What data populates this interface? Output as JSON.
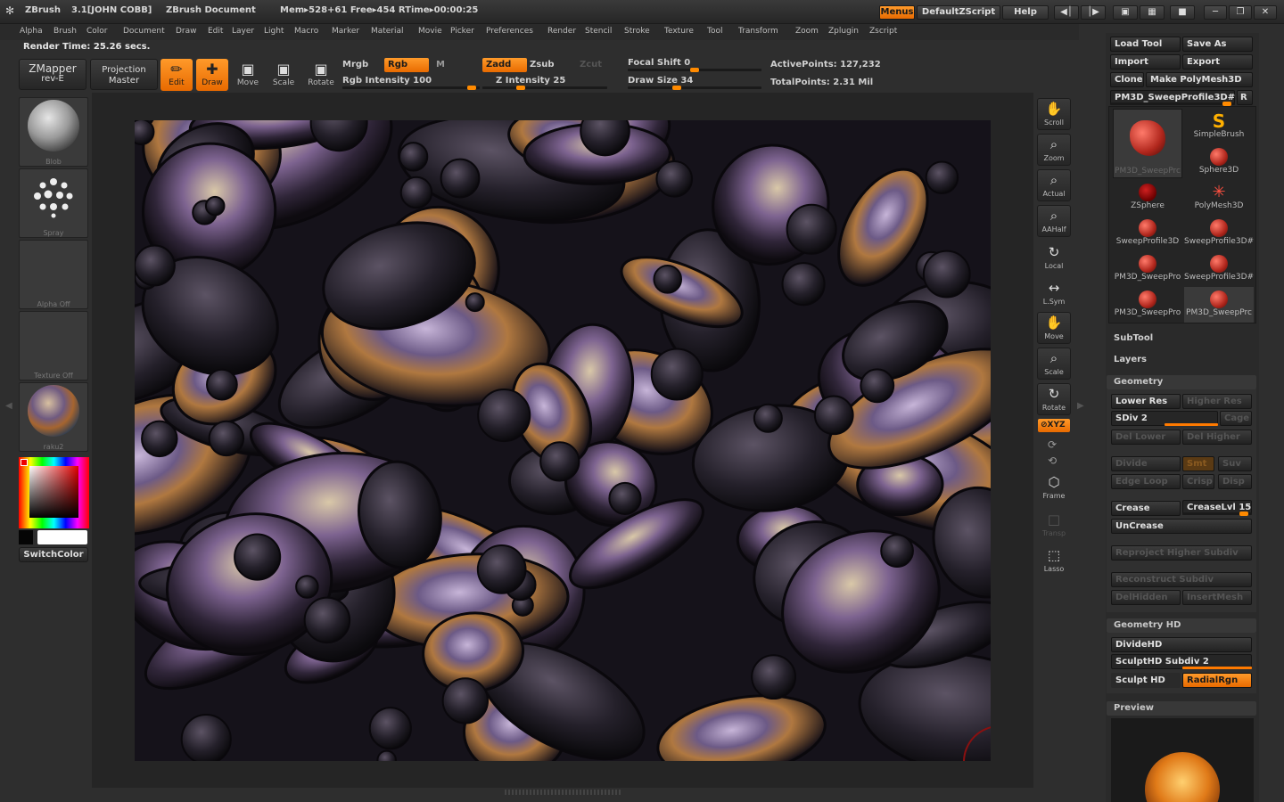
{
  "titlebar": {
    "app": "ZBrush",
    "version": "3.1[JOHN COBB]",
    "doc": "ZBrush Document",
    "mem": "Mem▸528+61 Free▸454 RTime▸00:00:25",
    "menus": "Menus",
    "script": "DefaultZScript",
    "help": "Help"
  },
  "menu": [
    "Alpha",
    "Brush",
    "Color",
    "Document",
    "Draw",
    "Edit",
    "Layer",
    "Light",
    "Macro",
    "Marker",
    "Material",
    "Movie",
    "Picker",
    "Preferences",
    "Render",
    "Stencil",
    "Stroke",
    "Texture",
    "Tool",
    "Transform",
    "Zoom",
    "Zplugin",
    "Zscript"
  ],
  "render_time": "Render Time: 25.26 secs.",
  "shelf": {
    "zmapper": "ZMapper",
    "zmapper_sub": "rev-E",
    "projection": "Projection",
    "projection_sub": "Master",
    "edit": "Edit",
    "draw": "Draw",
    "move": "Move",
    "scale": "Scale",
    "rotate": "Rotate",
    "mrgb": "Mrgb",
    "rgb": "Rgb",
    "m": "M",
    "rgb_intensity": "Rgb Intensity 100",
    "zadd": "Zadd",
    "zsub": "Zsub",
    "zcut": "Zcut",
    "z_intensity": "Z Intensity 25",
    "focal_shift": "Focal Shift 0",
    "draw_size": "Draw Size 34",
    "active_points": "ActivePoints: 127,232",
    "total_points": "TotalPoints: 2.31  Mil",
    "rgb_intensity_val": 100,
    "z_intensity_val": 25,
    "focal_shift_val": 0,
    "draw_size_val": 34
  },
  "left": {
    "brush": "Blob",
    "stroke": "Spray",
    "alpha": "Alpha  Off",
    "texture": "Texture  Off",
    "material": "raku2",
    "switch": "SwitchColor"
  },
  "right_shelf": [
    "Scroll",
    "Zoom",
    "Actual",
    "AAHalf",
    "Local",
    "L.Sym",
    "Move",
    "Scale",
    "Rotate",
    "Frame",
    "Transp",
    "Lasso"
  ],
  "xyz": "⊘XYZ",
  "panel": {
    "load_tool": "Load  Tool",
    "save_as": "Save  As",
    "import": "Import",
    "export": "Export",
    "clone": "Clone",
    "make_polymesh": "Make  PolyMesh3D",
    "current_tool": "PM3D_SweepProfile3D#",
    "r": "R",
    "tools": [
      {
        "label": "PM3D_SweepPrc"
      },
      {
        "label": "SimpleBrush"
      },
      {
        "label": "Sphere3D"
      },
      {
        "label": "ZSphere"
      },
      {
        "label": "PolyMesh3D"
      },
      {
        "label": "SweepProfile3D"
      },
      {
        "label": "SweepProfile3D#"
      },
      {
        "label": "PM3D_SweepPro"
      },
      {
        "label": "SweepProfile3D#"
      },
      {
        "label": "PM3D_SweepPro"
      },
      {
        "label": "PM3D_SweepPrc"
      }
    ],
    "subtool": "SubTool",
    "layers": "Layers",
    "geometry": "Geometry",
    "lower_res": "Lower  Res",
    "higher_res": "Higher  Res",
    "sdiv": "SDiv  2",
    "cage": "Cage",
    "del_lower": "Del  Lower",
    "del_higher": "Del  Higher",
    "divide": "Divide",
    "smt": "Smt",
    "suv": "Suv",
    "edge_loop": "Edge  Loop",
    "crisp": "Crisp",
    "disp": "Disp",
    "crease": "Crease",
    "crease_lvl": "CreaseLvl 15",
    "uncrease": "UnCrease",
    "reproject": "Reproject  Higher  Subdiv",
    "reconstruct": "Reconstruct  Subdiv",
    "delhidden": "DelHidden",
    "insertmesh": "InsertMesh",
    "geometry_hd": "Geometry  HD",
    "dividehd": "DivideHD",
    "sculpthd_subdiv": "SculptHD  Subdiv 2",
    "sculpt_hd": "Sculpt  HD",
    "radialrgn": "RadialRgn",
    "preview": "Preview"
  },
  "colors": {
    "accent": "#ff8a00",
    "bg": "#2e2e2e"
  }
}
